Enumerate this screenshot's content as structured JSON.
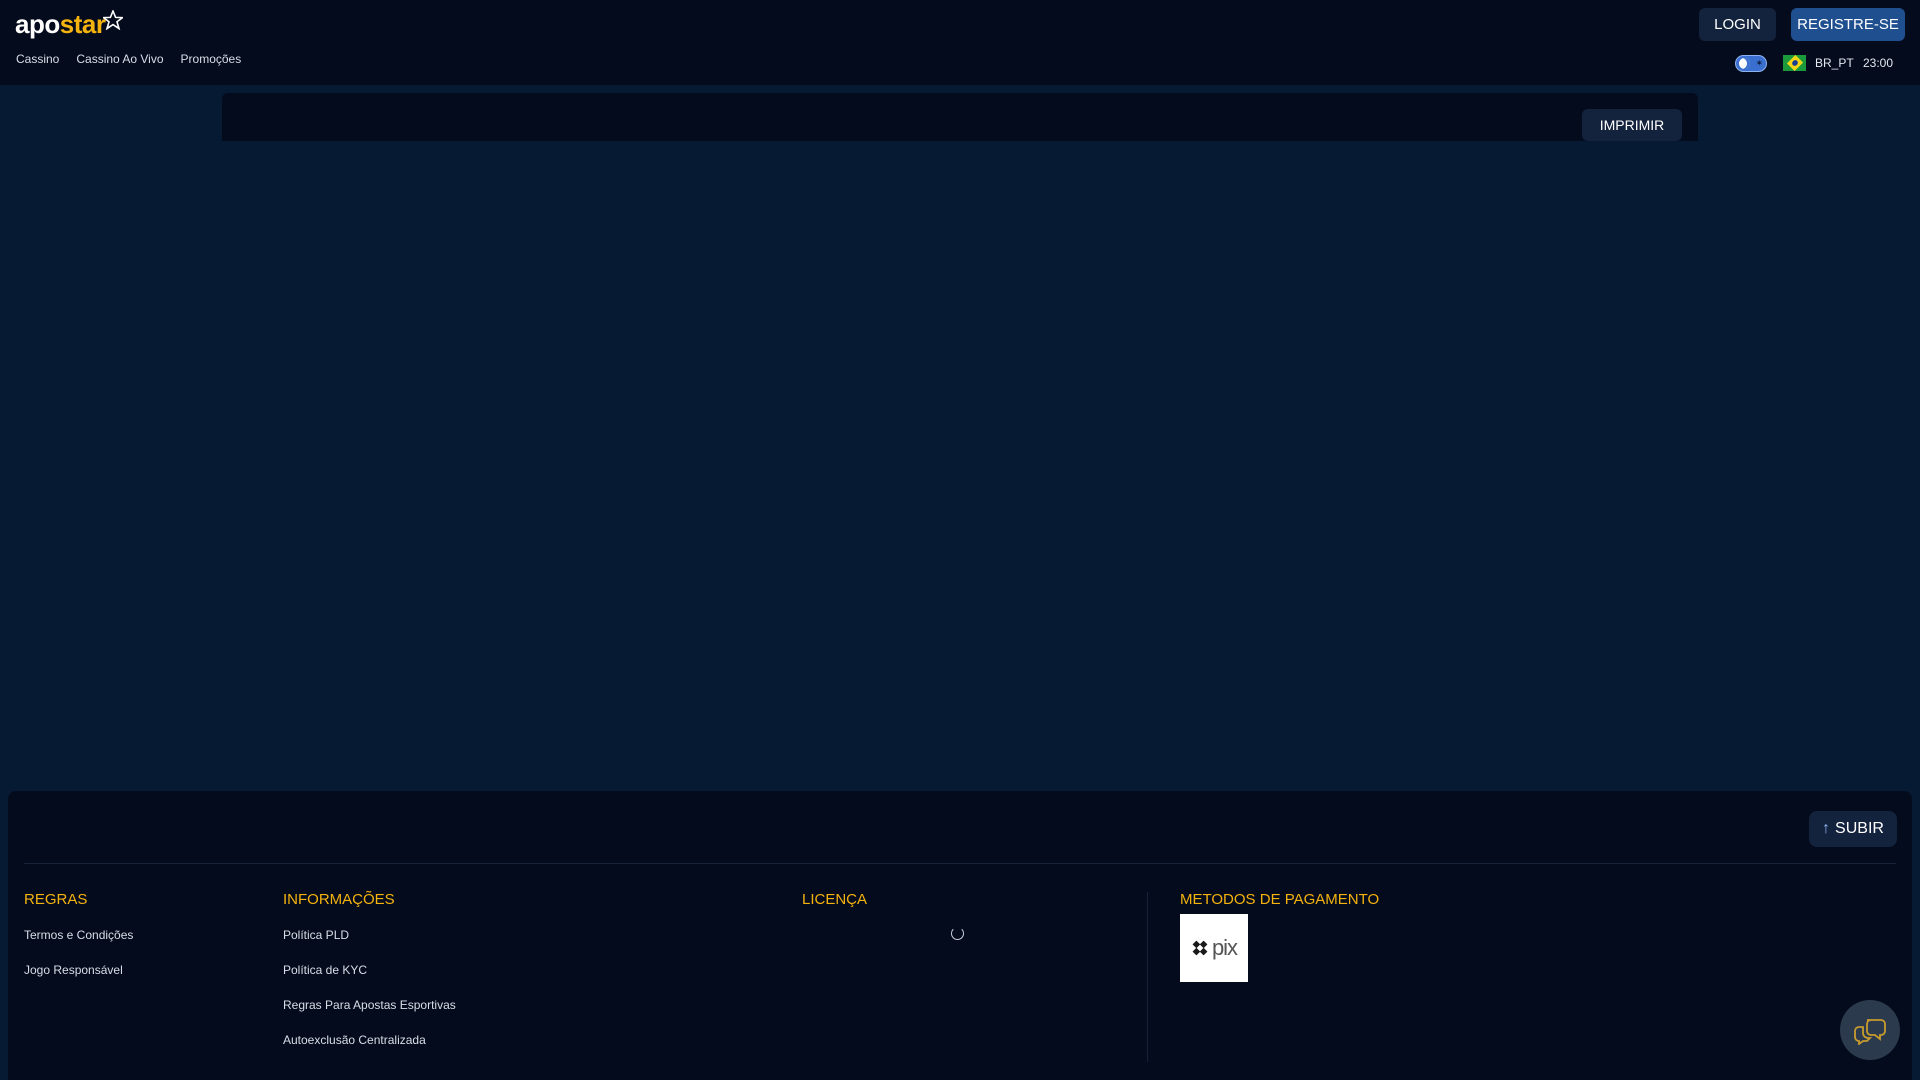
{
  "header": {
    "logo": {
      "part1": "apo",
      "part2": "star"
    },
    "nav": [
      "Cassino",
      "Cassino Ao Vivo",
      "Promoções"
    ],
    "login_label": "LOGIN",
    "register_label": "REGISTRE-SE",
    "language": "BR_PT",
    "time": "23:00",
    "theme_toggle": "dark"
  },
  "content": {
    "print_label": "IMPRIMIR"
  },
  "footer": {
    "up_label": "SUBIR",
    "columns": {
      "rules": {
        "title": "REGRAS",
        "links": [
          "Termos e Condições",
          "Jogo Responsável"
        ]
      },
      "info": {
        "title": "INFORMAÇÕES",
        "links": [
          "Política PLD",
          "Política de KYC",
          "Regras Para Apostas Esportivas",
          "Autoexclusão Centralizada"
        ]
      },
      "license": {
        "title": "LICENÇA"
      },
      "payment": {
        "title": "METODOS DE PAGAMENTO",
        "methods": [
          "pix"
        ]
      }
    }
  },
  "colors": {
    "background": "#061a33",
    "header_bg": "#040b1c",
    "accent": "#f5b30f",
    "primary_button": "#1f4f8e",
    "secondary_button": "#14233d"
  },
  "icons": [
    "star-icon",
    "theme-toggle-icon",
    "brazil-flag-icon",
    "arrow-up-icon",
    "pix-logo-icon",
    "chat-icon",
    "loading-spinner-icon"
  ]
}
